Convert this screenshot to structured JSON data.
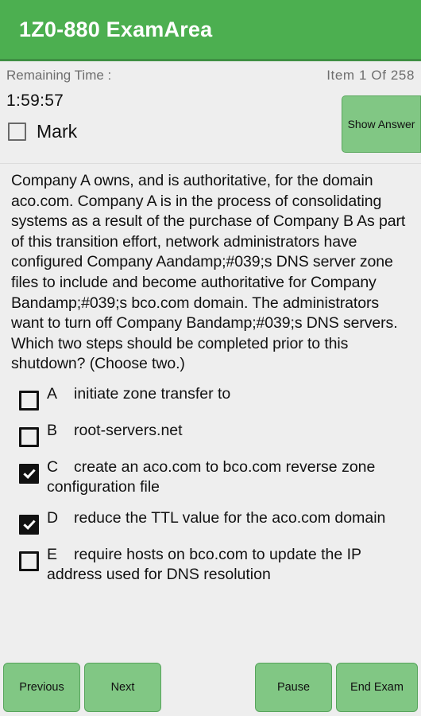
{
  "app": {
    "title": "1Z0-880 ExamArea",
    "header_color": "#4CAF50",
    "button_color": "#81C784",
    "background_color": "#EEEEEE"
  },
  "status": {
    "remaining_time_label": "Remaining Time :",
    "item_counter": "Item 1 Of 258",
    "time_value": "1:59:57"
  },
  "mark": {
    "label": "Mark",
    "checked": false
  },
  "show_answer": {
    "label": "Show Answer"
  },
  "question": {
    "text": "Company A owns, and is authoritative, for the domain aco.com. Company A is in the process of consolidating systems as a result of the purchase of Company B As part of this transition effort, network administrators have configured Company Aandamp;#039;s DNS server zone files to include and become authoritative for Company Bandamp;#039;s bco.com domain. The administrators want to turn off Company Bandamp;#039;s DNS servers. Which two steps should be completed prior to this shutdown? (Choose two.)"
  },
  "options": [
    {
      "letter": "A",
      "text": "initiate zone transfer to",
      "checked": false
    },
    {
      "letter": "B",
      "text": "root-servers.net",
      "checked": false
    },
    {
      "letter": "C",
      "text": "create an aco.com to bco.com reverse zone configuration file",
      "checked": true
    },
    {
      "letter": "D",
      "text": "reduce the TTL value for the aco.com domain",
      "checked": true
    },
    {
      "letter": "E",
      "text": "require hosts on bco.com to update the IP address used for DNS resolution",
      "checked": false
    }
  ],
  "bottom_bar": {
    "previous": "Previous",
    "next": "Next",
    "pause": "Pause",
    "end_exam": "End Exam"
  }
}
